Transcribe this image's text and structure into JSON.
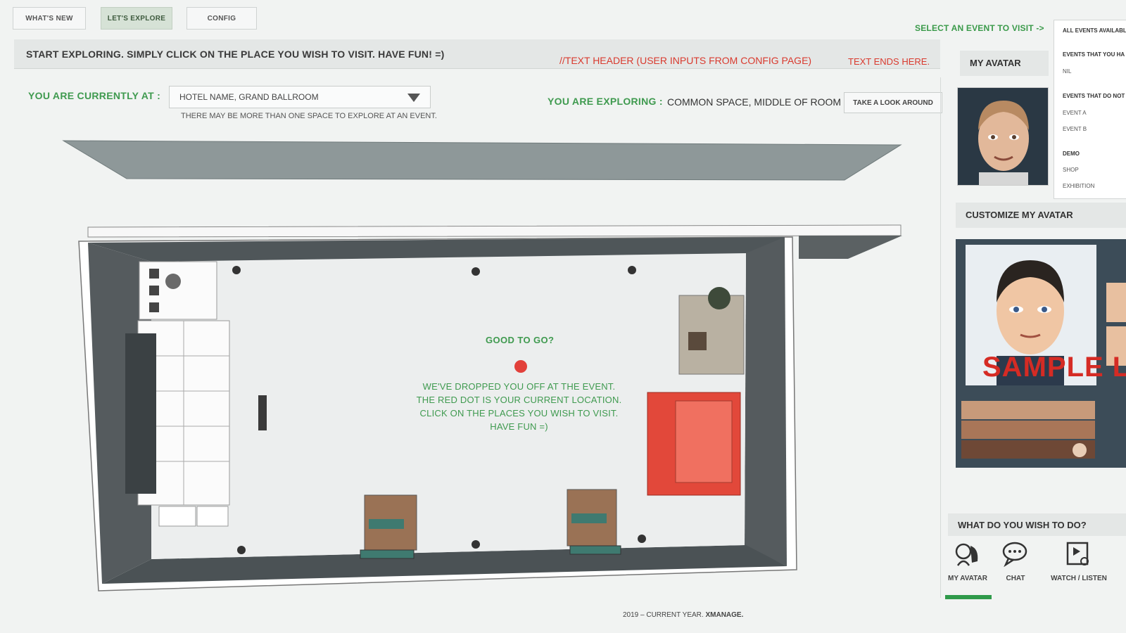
{
  "tabs": [
    {
      "label": "WHAT'S NEW"
    },
    {
      "label": "LET'S EXPLORE"
    },
    {
      "label": "CONFIG"
    }
  ],
  "select_event": "SELECT AN EVENT TO VISIT ->",
  "events_panel": {
    "all_events": "ALL EVENTS AVAILABL",
    "events_have": "EVENTS THAT YOU HA",
    "nil": "NIL",
    "events_not": "EVENTS THAT DO NOT",
    "event_a": "EVENT A",
    "event_b": "EVENT B",
    "demo": "DEMO",
    "shop": "SHOP",
    "exhibition": "EXHIBITION"
  },
  "header": {
    "main": "START EXPLORING. SIMPLY CLICK ON THE PLACE YOU WISH TO VISIT. HAVE FUN! =)",
    "note": "//TEXT HEADER (USER INPUTS FROM CONFIG PAGE)",
    "end": "TEXT ENDS HERE."
  },
  "location": {
    "current_label": "YOU ARE CURRENTLY AT :",
    "current_value": "HOTEL NAME, GRAND BALLROOM",
    "hint": "THERE MAY BE MORE THAN ONE SPACE TO EXPLORE AT AN EVENT.",
    "exploring_label": "YOU ARE EXPLORING :",
    "exploring_value": "COMMON SPACE, MIDDLE OF ROOM",
    "look_button": "TAKE A LOOK AROUND"
  },
  "sidebar": {
    "my_avatar": "MY AVATAR",
    "customize": "CUSTOMIZE MY AVATAR",
    "sample_text": "SAMPLE L",
    "wish_title": "WHAT DO YOU WISH TO DO?",
    "actions": [
      {
        "label": "MY AVATAR",
        "icon": "avatar-icon"
      },
      {
        "label": "CHAT",
        "icon": "chat-icon"
      },
      {
        "label": "WATCH / LISTEN",
        "icon": "media-icon"
      }
    ]
  },
  "map": {
    "title": "GOOD TO GO?",
    "msg1": "WE'VE DROPPED YOU OFF AT THE EVENT.",
    "msg2": "THE RED DOT IS YOUR CURRENT LOCATION.",
    "msg3": "CLICK ON THE PLACES YOU WISH TO VISIT.",
    "msg4": "HAVE FUN =)"
  },
  "footer": {
    "year": "2019 – CURRENT YEAR.",
    "brand": "XMANAGE."
  },
  "colors": {
    "accent_green": "#3f9a4f",
    "accent_red": "#d93a2e"
  }
}
